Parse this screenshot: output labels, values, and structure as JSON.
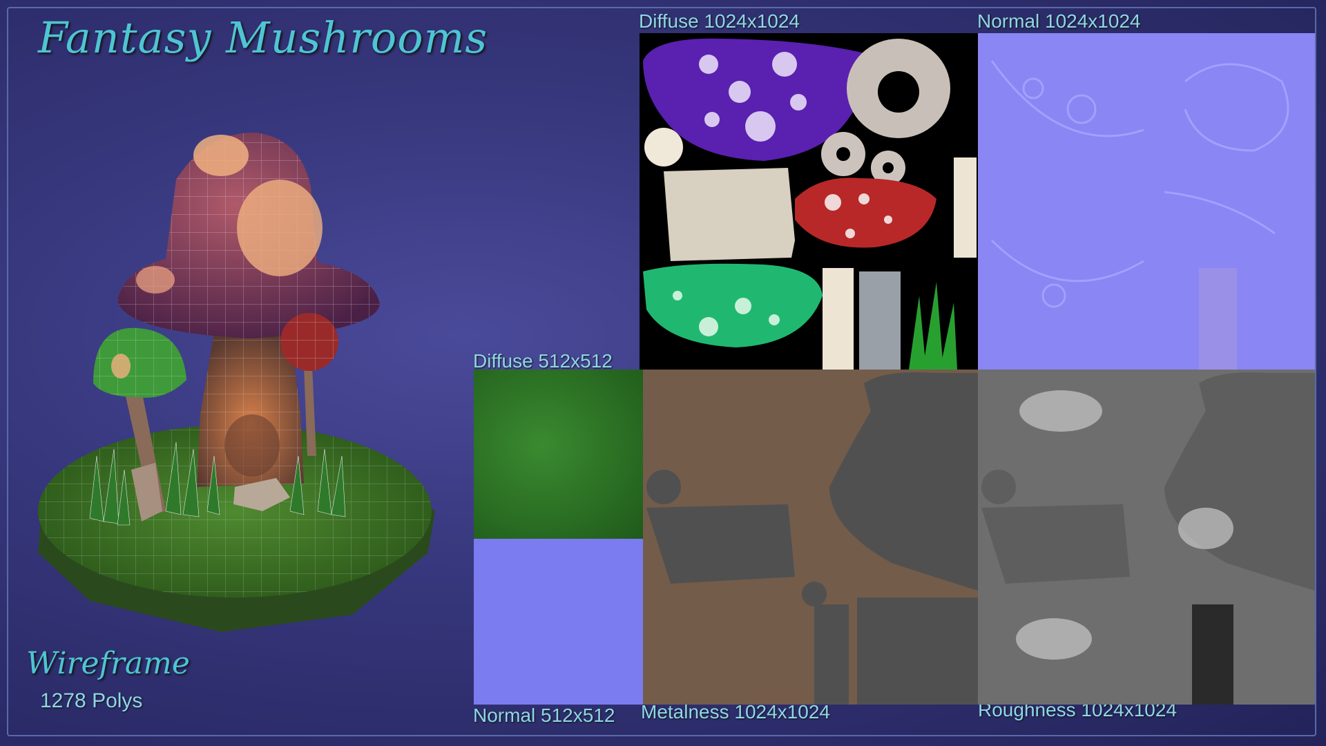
{
  "title": "Fantasy Mushrooms",
  "render": {
    "label": "Wireframe",
    "polys": "1278 Polys"
  },
  "textures": {
    "diffuse_large": "Diffuse 1024x1024",
    "normal_large": "Normal 1024x1024",
    "diffuse_small": "Diffuse 512x512",
    "normal_small": "Normal 512x512",
    "metalness": "Metalness 1024x1024",
    "roughness": "Roughness 1024x1024"
  },
  "colors": {
    "accent": "#4fc4d4",
    "label": "#8fd7e6",
    "background": "#35357a",
    "normal_map": "#8080f0",
    "metal_brown": "#745c4a",
    "metal_gray": "#505050",
    "rough_gray": "#707070"
  }
}
